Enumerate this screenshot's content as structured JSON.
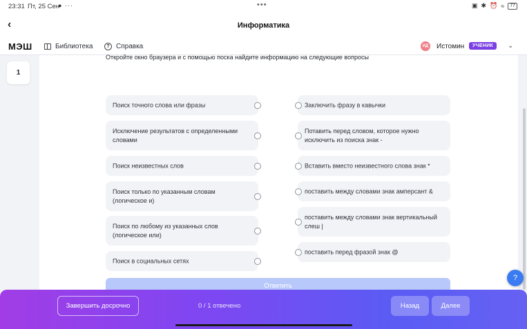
{
  "status_bar": {
    "time": "23:31",
    "date": "Пт, 25 Сен",
    "dots": "•••",
    "battery": "77"
  },
  "title_bar": {
    "title": "Информатика"
  },
  "nav": {
    "logo": "МЭШ",
    "library_label": "Библиотека",
    "help_label": "Справка",
    "avatar_initials": "ИД",
    "user_name": "Истомин",
    "role_badge": "УЧЕНИК"
  },
  "question_nav": {
    "current": "1"
  },
  "question": {
    "instructions": "Откройте окно браузера и с помощью поска найдите информацию на следующие вопросы",
    "left_options": [
      "Поиск точного слова или фразы",
      "Исключение результатов с определенными словами",
      "Поиск неизвестных слов",
      "Поиск только по указанным словам (логическое и)",
      "Поиск по любому из указанных слов (логическое или)",
      "Поиск в социальных сетях"
    ],
    "right_options": [
      "Заключить фразу в кавычки",
      "Потавить перед словом, которое нужно исключить из поиска знак -",
      "Вставить вместо неизвестного слова знак *",
      "поставить между словами знак амперсант &",
      "поставить между словами знак вертикальный слеш |",
      "поставить перед фразой знак @"
    ],
    "submit_label": "Ответить"
  },
  "help_fab": "?",
  "footer": {
    "finish_label": "Завершить досрочно",
    "progress": "0 / 1 отвечено",
    "prev_label": "Назад",
    "next_label": "Далее"
  },
  "colors": {
    "accent_purple": "#7b3fe4",
    "submit_disabled": "#b8c8fb",
    "help_blue": "#3a7bf1"
  }
}
